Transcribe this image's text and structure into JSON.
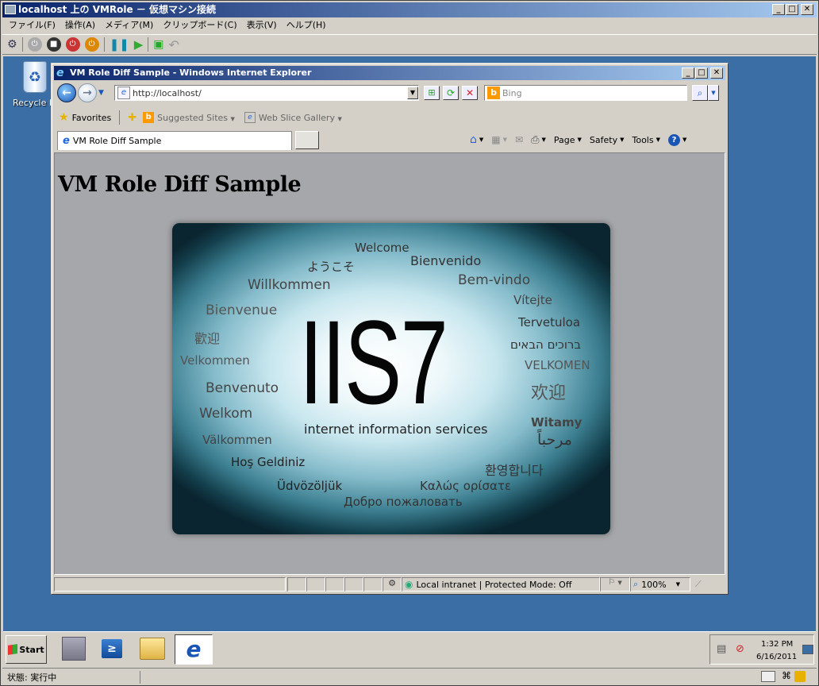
{
  "vm_window": {
    "title": "localhost 上の VMRole － 仮想マシン接続",
    "menus": [
      "ファイル(F)",
      "操作(A)",
      "メディア(M)",
      "クリップボード(C)",
      "表示(V)",
      "ヘルプ(H)"
    ],
    "status": "状態: 実行中"
  },
  "desktop": {
    "recycle_bin_label": "Recycle Bin"
  },
  "ie": {
    "title": "VM Role Diff Sample - Windows Internet Explorer",
    "address": "http://localhost/",
    "search_placeholder": "Bing",
    "favorites_label": "Favorites",
    "suggested_sites": "Suggested Sites",
    "web_slice_gallery": "Web Slice Gallery",
    "tab_title": "VM Role Diff Sample",
    "cmd_page": "Page",
    "cmd_safety": "Safety",
    "cmd_tools": "Tools",
    "status_zone": "Local intranet | Protected Mode: Off",
    "zoom": "100%"
  },
  "page": {
    "heading": "VM Role Diff Sample",
    "iis_logo": "IIS7",
    "iis_subtitle": "internet information services",
    "welcome_words": [
      "Welcome",
      "ようこそ",
      "Bienvenido",
      "Willkommen",
      "Bem-vindo",
      "Vítejte",
      "Bienvenue",
      "Tervetuloa",
      "歡迎",
      "ברוכים הבאים",
      "Velkommen",
      "VELKOMEN",
      "欢迎",
      "Benvenuto",
      "Welkom",
      "Witamy",
      "Välkommen",
      "مرحباً",
      "Hoş Geldiniz",
      "환영합니다",
      "Üdvözöljük",
      "Καλώς ορίσατε",
      "Добро пожаловать"
    ]
  },
  "taskbar": {
    "start": "Start",
    "time": "1:32 PM",
    "date": "6/16/2011"
  },
  "colors": {
    "desktop": "#3a6ea5",
    "title_active": "#0a246a",
    "title_gradient_end": "#a6caf0",
    "page_bg": "#a6a7aa"
  }
}
